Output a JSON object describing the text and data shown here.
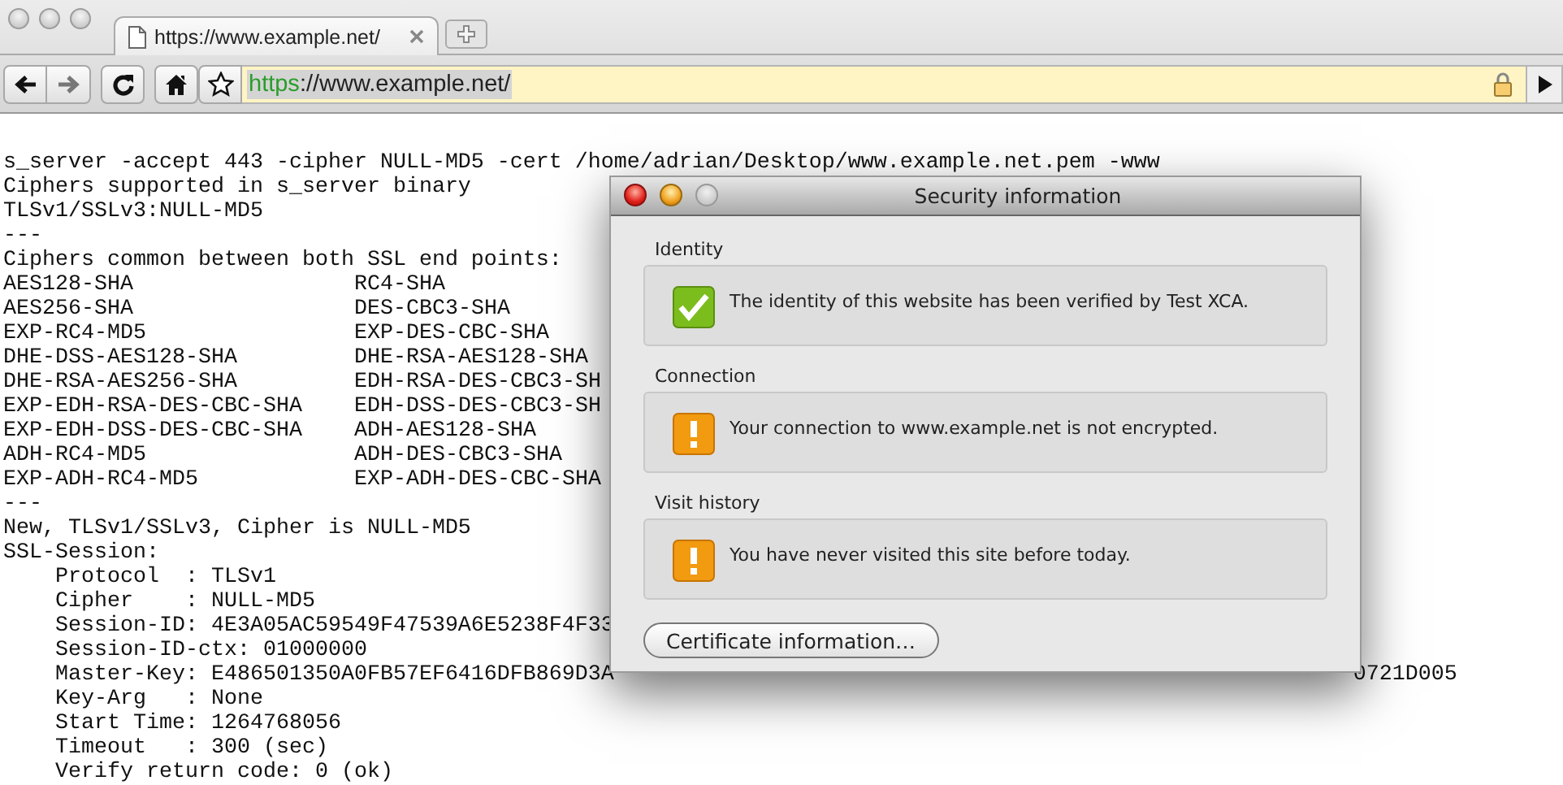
{
  "browser": {
    "tab": {
      "title": "https://www.example.net/"
    },
    "address": {
      "scheme": "https",
      "rest": "://www.example.net/",
      "selected": true
    }
  },
  "page": {
    "lines": [
      {
        "kind": "text",
        "text": "s_server -accept 443 -cipher NULL-MD5 -cert /home/adrian/Desktop/www.example.net.pem -www"
      },
      {
        "kind": "text",
        "text": "Ciphers supported in s_server binary"
      },
      {
        "kind": "text",
        "text": "TLSv1/SSLv3:NULL-MD5"
      },
      {
        "kind": "text",
        "text": "---"
      },
      {
        "kind": "text",
        "text": "Ciphers common between both SSL end points:"
      },
      {
        "kind": "columns",
        "cells": [
          "AES128-SHA",
          "RC4-SHA"
        ]
      },
      {
        "kind": "columns",
        "cells": [
          "AES256-SHA",
          "DES-CBC3-SHA"
        ]
      },
      {
        "kind": "columns",
        "cells": [
          "EXP-RC4-MD5",
          "EXP-DES-CBC-SHA"
        ]
      },
      {
        "kind": "columns",
        "cells": [
          "DHE-DSS-AES128-SHA",
          "DHE-RSA-AES128-SHA"
        ]
      },
      {
        "kind": "columns",
        "cells": [
          "DHE-RSA-AES256-SHA",
          "EDH-RSA-DES-CBC3-SH"
        ]
      },
      {
        "kind": "columns",
        "cells": [
          "EXP-EDH-RSA-DES-CBC-SHA",
          "EDH-DSS-DES-CBC3-SH"
        ]
      },
      {
        "kind": "columns",
        "cells": [
          "EXP-EDH-DSS-DES-CBC-SHA",
          "ADH-AES128-SHA"
        ]
      },
      {
        "kind": "columns",
        "cells": [
          "ADH-RC4-MD5",
          "ADH-DES-CBC3-SHA"
        ]
      },
      {
        "kind": "columns",
        "cells": [
          "EXP-ADH-RC4-MD5",
          "EXP-ADH-DES-CBC-SHA"
        ]
      },
      {
        "kind": "text",
        "text": "---"
      },
      {
        "kind": "text",
        "text": "New, TLSv1/SSLv3, Cipher is NULL-MD5"
      },
      {
        "kind": "text",
        "text": "SSL-Session:"
      },
      {
        "kind": "text",
        "text": "    Protocol  : TLSv1"
      },
      {
        "kind": "text",
        "text": "    Cipher    : NULL-MD5"
      },
      {
        "kind": "text",
        "text": "    Session-ID: 4E3A05AC59549F47539A6E5238F4F33"
      },
      {
        "kind": "text",
        "text": "    Session-ID-ctx: 01000000"
      },
      {
        "kind": "split",
        "text": "    Master-Key: E486501350A0FB57EF6416DFB869D3A",
        "tail": "0721D005"
      },
      {
        "kind": "text",
        "text": "    Key-Arg   : None"
      },
      {
        "kind": "text",
        "text": "    Start Time: 1264768056"
      },
      {
        "kind": "text",
        "text": "    Timeout   : 300 (sec)"
      },
      {
        "kind": "text",
        "text": "    Verify return code: 0 (ok)"
      }
    ]
  },
  "dialog": {
    "title": "Security information",
    "sections": [
      {
        "heading": "Identity",
        "kind": "ok",
        "message": "The identity of this website has been verified by Test XCA."
      },
      {
        "heading": "Connection",
        "kind": "warning",
        "message": "Your connection to www.example.net is not encrypted."
      },
      {
        "heading": "Visit history",
        "kind": "warning",
        "message": "You have never visited this site before today."
      }
    ],
    "button": "Certificate information…"
  }
}
